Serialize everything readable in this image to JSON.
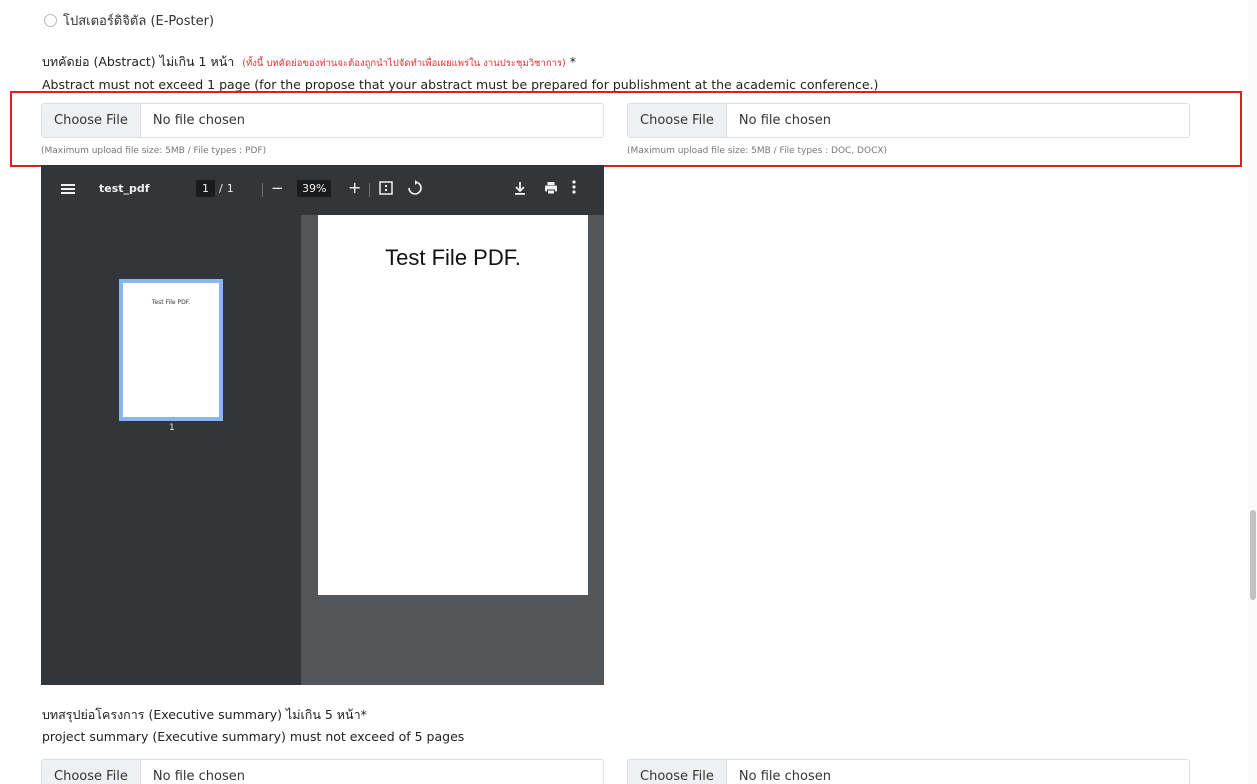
{
  "radio_option": {
    "label": "โปสเตอร์ดิจิตัล (E-Poster)"
  },
  "abstract": {
    "label": "บทคัดย่อ (Abstract) ไม่เกิน 1 หน้า",
    "note": "(ทั้งนี้ บทคัดย่อของท่านจะต้องถูกนำไปจัดทำเพื่อเผยแพร่ใน งานประชุมวิชาการ)",
    "required_mark": "*",
    "sub": "Abstract must not exceed 1 page (for the propose that your abstract must be prepared for publishment at the academic conference.)",
    "pdf_upload": {
      "button": "Choose File",
      "status": "No file chosen",
      "hint": "(Maximum upload file size: 5MB / File types : PDF)"
    },
    "doc_upload": {
      "button": "Choose File",
      "status": "No file chosen",
      "hint": "(Maximum upload file size: 5MB / File types : DOC, DOCX)"
    }
  },
  "pdf_viewer": {
    "title": "test_pdf",
    "page_current": "1",
    "page_total": "1",
    "zoom": "39%",
    "thumbnail_text": "Test File PDF.",
    "thumbnail_number": "1",
    "page_content": "Test File PDF."
  },
  "executive_summary": {
    "label": "บทสรุปย่อโครงการ (Executive summary) ไม่เกิน 5 หน้า*",
    "sub": "project summary (Executive summary) must not exceed of 5 pages",
    "pdf_upload": {
      "button": "Choose File",
      "status": "No file chosen"
    },
    "doc_upload": {
      "button": "Choose File",
      "status": "No file chosen"
    }
  },
  "colors": {
    "highlight": "#e01e1e",
    "note_red": "#e03131",
    "viewer_dark": "#323639"
  }
}
